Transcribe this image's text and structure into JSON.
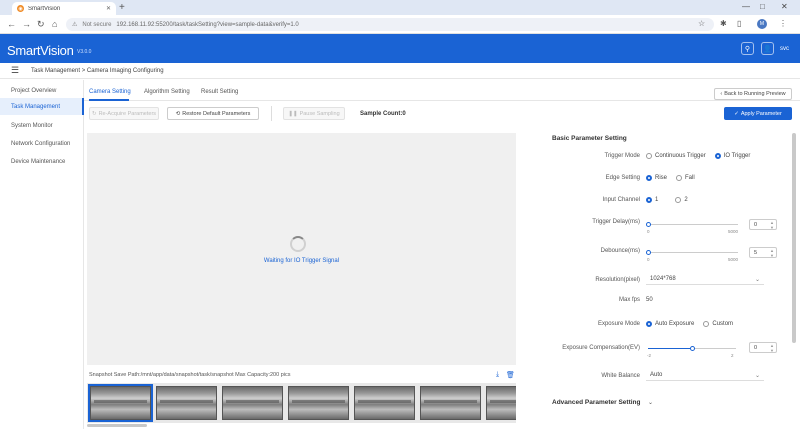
{
  "browser": {
    "tab_title": "SmartVision",
    "tab_favicon": "smartvision-favicon",
    "url_warning": "Not secure",
    "url": "192.168.11.92:55200/task/taskSetting?view=sample-data&verify=1.0",
    "profile_initial": "M"
  },
  "header": {
    "logo": "SmartVision",
    "version": "V3.0.0",
    "user": "svc"
  },
  "breadcrumb": "Task Management  >  Camera Imaging Configuring",
  "sidebar": {
    "items": [
      {
        "label": "Project Overview"
      },
      {
        "label": "Task Management"
      },
      {
        "label": "System Monitor"
      },
      {
        "label": "Network Configuration"
      },
      {
        "label": "Device Maintenance"
      }
    ]
  },
  "tabs": [
    {
      "label": "Camera Setting"
    },
    {
      "label": "Algorithm Setting"
    },
    {
      "label": "Result Setting"
    }
  ],
  "back_button": "Back to Running Preview",
  "toolbar": {
    "btn1": "Re-Acquire Parameters",
    "btn2": "Restore Default Parameters",
    "btn3": "Pause Sampling",
    "sample_count": "Sample Count:0",
    "apply": "Apply Parameter"
  },
  "viewer": {
    "waiting": "Waiting for IO Trigger Signal",
    "save_path": "Snapshot Save Path:/mnt/app/data/snapshot/task/snapshot  Max Capacity:200 pics"
  },
  "thumbnails": {
    "count": 7
  },
  "panel": {
    "title": "Basic Parameter Setting",
    "trigger_mode": {
      "label": "Trigger Mode",
      "opt1": "Continuous Trigger",
      "opt2": "IO Trigger",
      "selected": "IO Trigger"
    },
    "edge_setting": {
      "label": "Edge Setting",
      "opt1": "Rise",
      "opt2": "Fall",
      "selected": "Rise"
    },
    "input_channel": {
      "label": "Input Channel",
      "opt1": "1",
      "opt2": "2",
      "selected": "1"
    },
    "trigger_delay": {
      "label": "Trigger Delay(ms)",
      "min": "0",
      "max": "5000",
      "value": "0",
      "fraction": 0.0
    },
    "debounce": {
      "label": "Debounce(ms)",
      "min": "0",
      "max": "5000",
      "value": "5",
      "fraction": 0.001
    },
    "resolution": {
      "label": "Resolution(pixel)",
      "value": "1024*768"
    },
    "max_fps": {
      "label": "Max fps",
      "value": "50"
    },
    "exposure_mode": {
      "label": "Exposure Mode",
      "opt1": "Auto Exposure",
      "opt2": "Custom",
      "selected": "Auto Exposure"
    },
    "exposure_comp": {
      "label": "Exposure Compensation(EV)",
      "min": "-2",
      "max": "2",
      "value": "0",
      "fraction": 0.5
    },
    "white_balance": {
      "label": "White Balance",
      "value": "Auto"
    },
    "advanced": "Advanced Parameter Setting"
  },
  "colors": {
    "primary": "#1a63d4",
    "header": "#1a63d4"
  }
}
